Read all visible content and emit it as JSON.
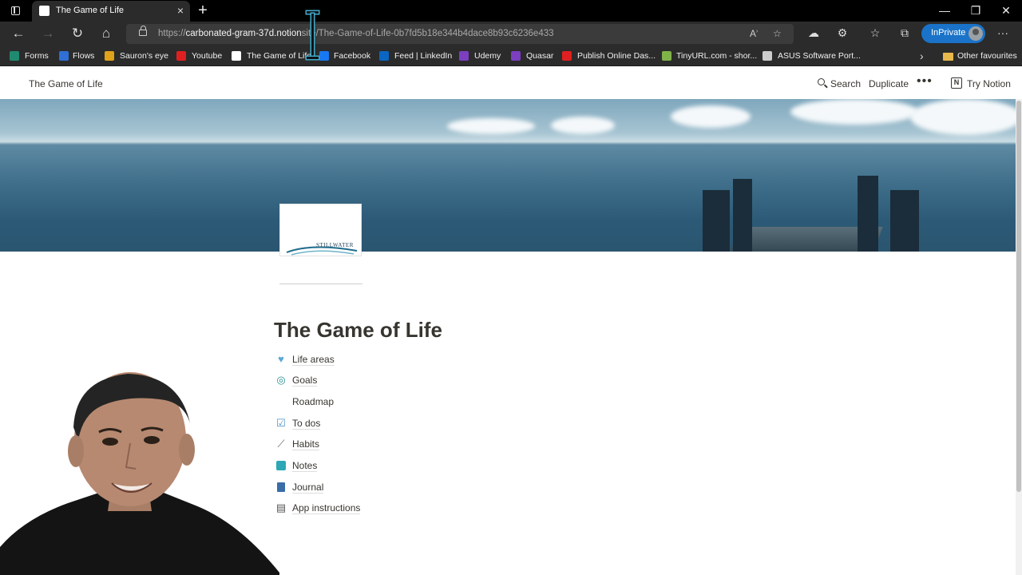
{
  "browser": {
    "tab_title": "The Game of Life",
    "new_tab": "+",
    "url_prefix": "https://",
    "url_host": "carbonated-gram-37d.notion",
    "url_site_suffix": "site",
    "url_path": "/The-Game-of-Life-0b7fd5b18e344b4dace8b93c6236e433",
    "inprivate_label": "InPrivate",
    "window_controls": {
      "minimize": "—",
      "maximize": "❐",
      "close": "✕"
    },
    "icons": [
      "sidebar-icon",
      "back-icon",
      "forward-icon",
      "refresh-icon",
      "home-icon",
      "lock-icon",
      "read-aloud-icon",
      "favorite-add-icon",
      "extension-cloud-icon",
      "extensions-icon",
      "favorites-icon",
      "collections-icon",
      "more-icon"
    ]
  },
  "bookmarks": [
    {
      "label": "Forms",
      "color": "#1f8a70"
    },
    {
      "label": "Flows",
      "color": "#2f6fd6"
    },
    {
      "label": "Sauron's eye",
      "color": "#e0a21a"
    },
    {
      "label": "Youtube",
      "color": "#e02020"
    },
    {
      "label": "The Game of Life",
      "color": "#ffffff"
    },
    {
      "label": "Facebook",
      "color": "#1877f2"
    },
    {
      "label": "Feed | LinkedIn",
      "color": "#0a66c2"
    },
    {
      "label": "Udemy",
      "color": "#7b3fbf"
    },
    {
      "label": "Quasar",
      "color": "#7b3fbf"
    },
    {
      "label": "Publish Online Das...",
      "color": "#e02020"
    },
    {
      "label": "TinyURL.com - shor...",
      "color": "#7fb34a"
    },
    {
      "label": "ASUS Software Port...",
      "color": "#cccccc"
    }
  ],
  "bookmarks_more": "Other favourites",
  "notion_header": {
    "breadcrumb": "The Game of Life",
    "search": "Search",
    "duplicate": "Duplicate",
    "more": "•••",
    "try_notion": "Try Notion",
    "notion_logo": "N"
  },
  "page": {
    "icon_text": "STILLWATER",
    "title": "The Game of Life",
    "links": [
      {
        "label": "Life areas",
        "icon": "heart-icon",
        "glyph": "💙",
        "color": "#5ba7d6"
      },
      {
        "label": "Goals",
        "icon": "target-icon",
        "glyph": "◎",
        "color": "#2c8f8f"
      },
      {
        "label": "Roadmap",
        "icon": "",
        "glyph": "",
        "color": "#ffffff"
      },
      {
        "label": "To dos",
        "icon": "checkbox-icon",
        "glyph": "☑",
        "color": "#4a90c8"
      },
      {
        "label": "Habits",
        "icon": "running-shoe-icon",
        "glyph": "👟",
        "color": "#666666"
      },
      {
        "label": "Notes",
        "icon": "notebook-icon",
        "glyph": "▬",
        "color": "#2ca7b5"
      },
      {
        "label": "Journal",
        "icon": "journal-icon",
        "glyph": "📘",
        "color": "#3a6da8"
      },
      {
        "label": "App instructions",
        "icon": "manual-icon",
        "glyph": "▤",
        "color": "#555555"
      }
    ]
  }
}
